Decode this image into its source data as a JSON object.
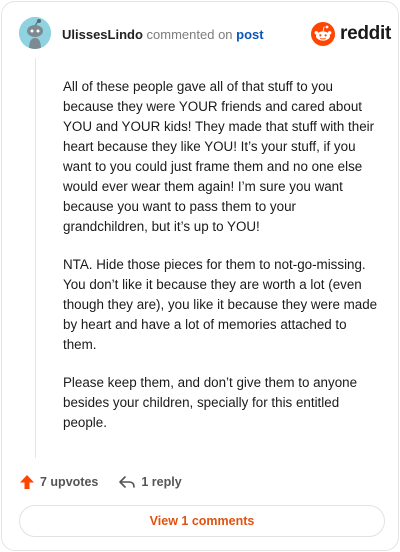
{
  "header": {
    "username": "UlissesLindo",
    "action_text": "commented on",
    "post_link": "post",
    "brand": "reddit"
  },
  "comment": {
    "paragraphs": [
      "All of these people gave all of that stuff to you because they were YOUR friends and cared about YOU and YOUR kids! They made that stuff with their heart because they like YOU! It’s your stuff, if you want to you could just frame them and no one else would ever wear them again! I’m sure you want because you want to pass them to your grandchildren, but it’s up to YOU!",
      "NTA. Hide those pieces for them to not-go-missing. You don’t like it because they are worth a lot (even though they are), you like it because they were made by heart and have a lot of memories attached to them.",
      "Please keep them, and don’t give them to anyone besides your children, specially for this entitled people."
    ]
  },
  "actions": {
    "upvotes_label": "7 upvotes",
    "reply_label": "1 reply"
  },
  "footer": {
    "view_comments_label": "View 1 comments"
  },
  "colors": {
    "accent": "#ff4500",
    "link": "#0a57b8",
    "view_button_text": "#e0520f",
    "avatar_bg": "#8fd3e0"
  },
  "icons": [
    "snoo-avatar-icon",
    "reddit-logo-icon",
    "upvote-arrow-icon",
    "reply-icon"
  ]
}
